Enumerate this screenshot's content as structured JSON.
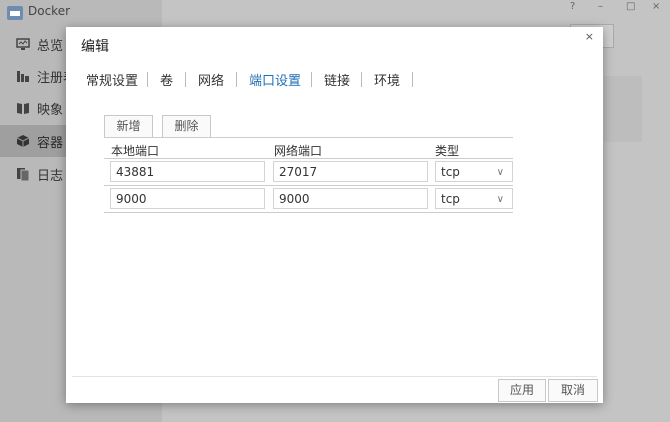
{
  "app": {
    "title": "Docker",
    "sidebar": [
      {
        "label": "总览",
        "icon": "monitor-icon"
      },
      {
        "label": "注册表",
        "icon": "registry-icon"
      },
      {
        "label": "映象",
        "icon": "book-icon"
      },
      {
        "label": "容器",
        "icon": "cube-icon"
      },
      {
        "label": "日志",
        "icon": "log-icon"
      }
    ],
    "window_controls": {
      "help": "?",
      "minimize": "–",
      "maximize": "□",
      "close": "×"
    }
  },
  "dialog": {
    "title": "编辑",
    "close": "×",
    "tabs": [
      "常规设置",
      "卷",
      "网络",
      "端口设置",
      "链接",
      "环境"
    ],
    "active_tab": "端口设置",
    "toolbar": {
      "add": "新增",
      "delete": "删除"
    },
    "columns": {
      "local_port": "本地端口",
      "network_port": "网络端口",
      "type": "类型"
    },
    "rows": [
      {
        "local_port": "43881",
        "network_port": "27017",
        "type": "tcp"
      },
      {
        "local_port": "9000",
        "network_port": "9000",
        "type": "tcp"
      }
    ],
    "footer": {
      "apply": "应用",
      "cancel": "取消"
    }
  },
  "colors": {
    "accent": "#1f6fb5",
    "overlay": "#c4c4c4"
  }
}
